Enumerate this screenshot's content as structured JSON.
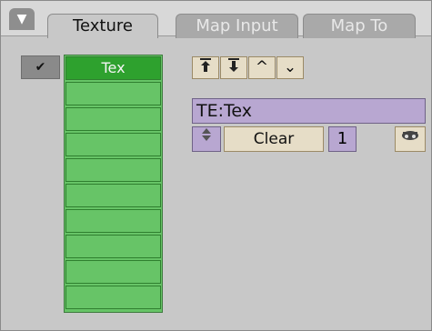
{
  "header": {
    "collapse_icon": "triangle-down-icon",
    "tabs": [
      {
        "label": "Texture",
        "active": true
      },
      {
        "label": "Map Input",
        "active": false
      },
      {
        "label": "Map To",
        "active": false
      }
    ]
  },
  "slots": {
    "enabled_icon": "checkmark-icon",
    "items": [
      "Tex",
      "",
      "",
      "",
      "",
      "",
      "",
      "",
      "",
      ""
    ]
  },
  "toolbar": {
    "copy_icon": "copy-arrow-icon",
    "paste_icon": "paste-arrow-icon",
    "up_icon": "caret-up-icon",
    "down_icon": "caret-down-icon"
  },
  "texture": {
    "name_value": "TE:Tex",
    "browse_icon": "browse-arrows-icon",
    "clear_label": "Clear",
    "users_count": "1",
    "fake_user_icon": "fake-user-icon"
  },
  "colors": {
    "panel_bg": "#c8c8c8",
    "slot_green": "#67c467",
    "slot_active": "#2ea12e",
    "field_purple": "#b8a7d1",
    "button_beige": "#e6ddc7"
  }
}
